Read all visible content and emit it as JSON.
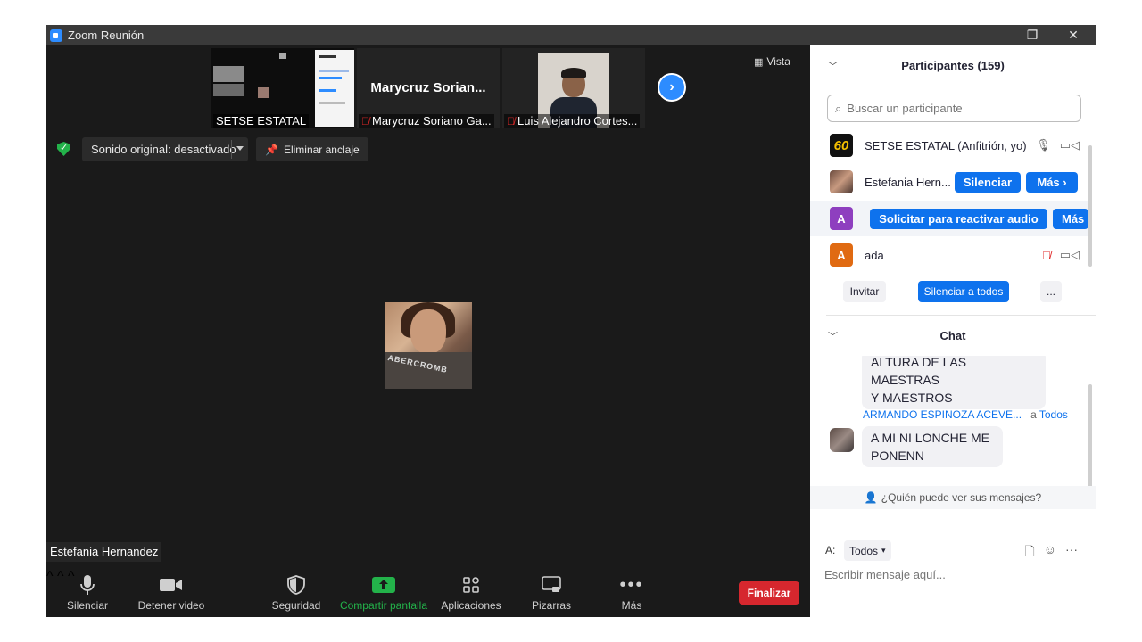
{
  "window": {
    "title": "Zoom Reunión",
    "controls": {
      "minimize": "–",
      "restore": "❐",
      "close": "✕"
    }
  },
  "thumbnails": [
    {
      "label": "SETSE ESTATAL",
      "muted": false
    },
    {
      "bigname": "Marycruz  Sorian...",
      "label": "Marycruz Soriano Ga...",
      "muted": true
    },
    {
      "label": "Luis Alejandro Cortes...",
      "muted": true
    }
  ],
  "next_icon": "chevron-right-icon",
  "view_button": "Vista",
  "meeting_bar": {
    "sound_original": "Sonido original: desactivado",
    "unpin": "Eliminar anclaje"
  },
  "active_speaker_name": "Estefania Hernandez",
  "toolbar": {
    "mute": "Silenciar",
    "stop_video": "Detener video",
    "security": "Seguridad",
    "share_screen": "Compartir pantalla",
    "apps": "Aplicaciones",
    "whiteboards": "Pizarras",
    "more": "Más",
    "end": "Finalizar"
  },
  "participants": {
    "header": "Participantes (159)",
    "search_placeholder": "Buscar un participante",
    "list": [
      {
        "name": "SETSE ESTATAL (Anfitrión, yo)",
        "avatar": "60"
      },
      {
        "name": "Estefania Hern...",
        "mute_button": "Silenciar",
        "more_button": "Más ›"
      },
      {
        "avatar": "A",
        "request_button": "Solicitar para reactivar audio",
        "more_button": "Más"
      },
      {
        "name": "ada",
        "avatar": "A"
      }
    ],
    "invite": "Invitar",
    "mute_all": "Silenciar a todos",
    "more": "..."
  },
  "chat": {
    "header": "Chat",
    "messages": [
      {
        "text_line1": "ALTURA DE LAS MAESTRAS",
        "text_line2": "Y MAESTROS"
      },
      {
        "sender": "ARMANDO ESPINOZA ACEVE...",
        "to_prefix": "a",
        "to": "Todos",
        "text_line1": "A MI NI LONCHE ME",
        "text_line2": "PONENN"
      }
    ],
    "who_can_see": "¿Quién puede ver sus mensajes?",
    "to_label": "A:",
    "to_value": "Todos",
    "input_placeholder": "Escribir mensaje aquí...",
    "more_icon_text": "···"
  },
  "colors": {
    "accent": "#0e72ed",
    "share_green": "#23b24a",
    "end_red": "#d6272e",
    "muted_red": "#e02828"
  }
}
